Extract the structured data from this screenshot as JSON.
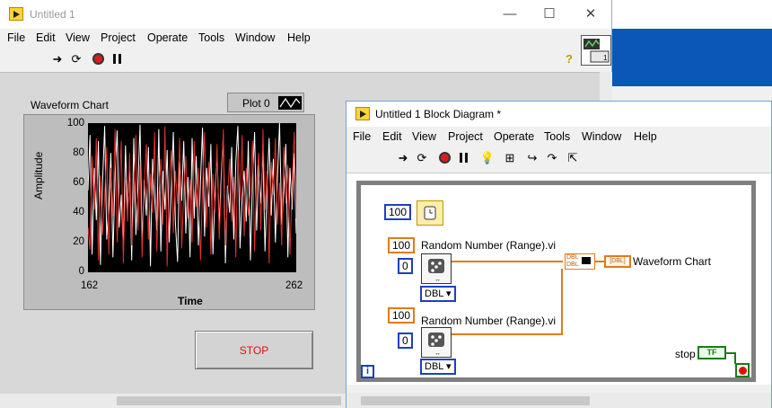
{
  "front_panel": {
    "title": "Untitled 1",
    "menu": [
      "File",
      "Edit",
      "View",
      "Project",
      "Operate",
      "Tools",
      "Window",
      "Help"
    ],
    "window_controls": {
      "minimize": "—",
      "maximize": "☐",
      "close": "✕"
    },
    "chart": {
      "title": "Waveform Chart",
      "legend_label": "Plot 0",
      "y_axis_label": "Amplitude",
      "x_axis_label": "Time",
      "y_ticks": [
        "100",
        "80",
        "60",
        "40",
        "20",
        "0"
      ],
      "x_ticks": [
        "162",
        "262"
      ]
    },
    "stop_button_label": "STOP",
    "help_glyph": "?"
  },
  "chart_data": {
    "type": "line",
    "xlabel": "Time",
    "ylabel": "Amplitude",
    "xlim": [
      162,
      262
    ],
    "ylim": [
      0,
      100
    ],
    "series": [
      {
        "color": "#ffffff",
        "values": [
          55,
          92,
          12,
          70,
          35,
          88,
          5,
          60,
          98,
          22,
          45,
          80,
          10,
          66,
          95,
          30,
          52,
          15,
          85,
          40,
          72,
          8,
          90,
          25,
          58,
          99,
          18,
          62,
          38,
          84,
          4,
          76,
          50,
          28,
          96,
          14,
          68,
          42,
          82,
          20,
          56,
          94,
          33,
          7,
          74,
          48,
          88,
          26,
          64,
          10,
          90,
          36,
          78,
          18,
          60,
          97,
          24,
          70,
          44,
          86,
          12,
          52,
          80,
          30,
          66,
          92,
          6,
          58,
          40,
          84,
          22,
          74,
          98,
          16,
          50,
          68,
          34,
          88,
          8,
          62,
          94,
          28,
          72,
          46,
          82,
          14,
          56,
          90,
          38,
          76,
          20,
          64,
          100,
          32,
          54,
          86,
          10,
          70,
          42,
          80,
          26
        ]
      },
      {
        "color": "#e0302c",
        "values": [
          30,
          15,
          78,
          42,
          90,
          8,
          65,
          25,
          50,
          84,
          12,
          70,
          38,
          96,
          20,
          55,
          88,
          6,
          62,
          34,
          80,
          18,
          48,
          92,
          28,
          72,
          10,
          58,
          86,
          22,
          66,
          40,
          94,
          14,
          52,
          76,
          32,
          98,
          4,
          60,
          82,
          26,
          68,
          46,
          90,
          16,
          54,
          78,
          36,
          62,
          20,
          88,
          44,
          70,
          8,
          56,
          94,
          30,
          74,
          12,
          66,
          40,
          86,
          22,
          58,
          96,
          18,
          50,
          76,
          34,
          64,
          10,
          82,
          48,
          92,
          24,
          70,
          38,
          56,
          88,
          14,
          62,
          80,
          28,
          96,
          42,
          68,
          6,
          74,
          52,
          90,
          32,
          60,
          18,
          84,
          46,
          72,
          12,
          58,
          94,
          36
        ]
      }
    ]
  },
  "block_diagram": {
    "title": "Untitled 1 Block Diagram *",
    "menu": [
      "File",
      "Edit",
      "View",
      "Project",
      "Operate",
      "Tools",
      "Window",
      "Help"
    ],
    "wait_constant": "100",
    "random1": {
      "label": "Random Number (Range).vi",
      "high": "100",
      "low": "0",
      "rep": "DBL"
    },
    "random2": {
      "label": "Random Number (Range).vi",
      "high": "100",
      "low": "0",
      "rep": "DBL"
    },
    "bundle_terms": [
      "DBL",
      "DBL"
    ],
    "chart_terminal_label": "Waveform Chart",
    "chart_terminal_glyph": "[DBL]",
    "stop_label": "stop",
    "stop_terminal_text": "TF",
    "iteration_terminal": "i"
  }
}
